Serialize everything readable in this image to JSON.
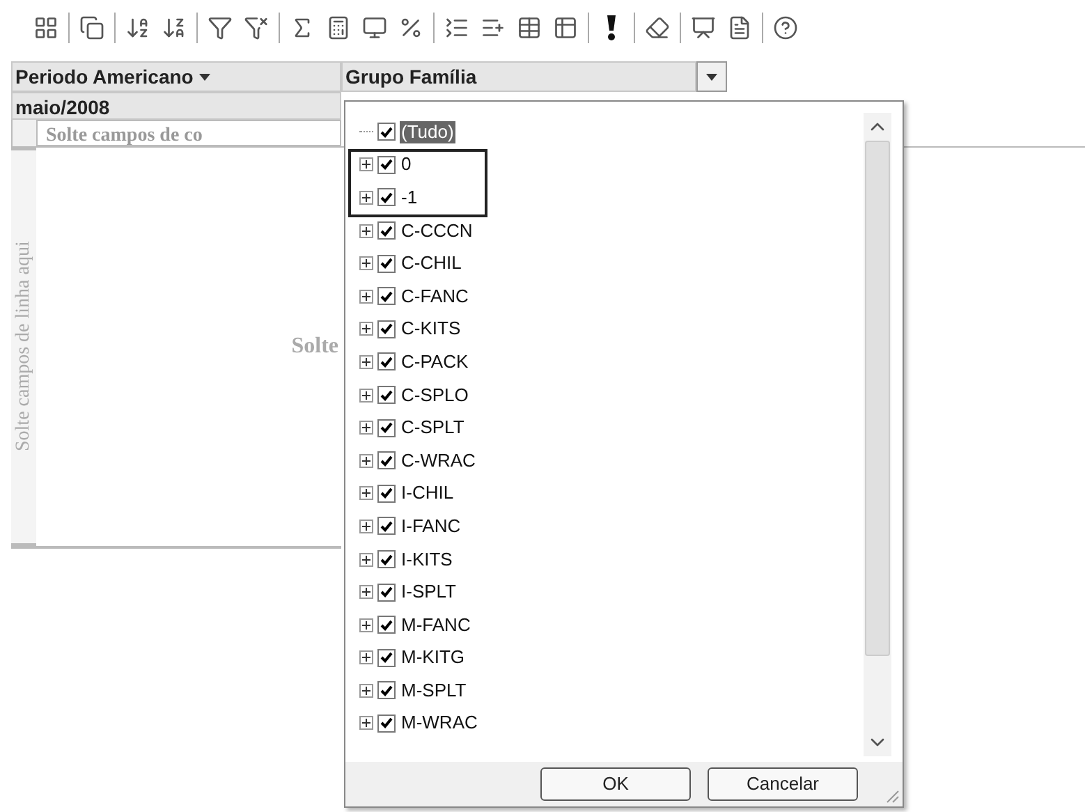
{
  "pivot": {
    "page_field": {
      "label": "Periodo Americano",
      "value": "maio/2008"
    },
    "column_field": {
      "label": "Grupo Família"
    },
    "column_drop_zone": "Solte campos de co",
    "row_drop_zone": "Solte campos de linha aqui",
    "data_drop_zone": "Solte"
  },
  "filter_popup": {
    "items": [
      {
        "label": "(Tudo)",
        "checked": true,
        "selected": true,
        "kind": "all"
      },
      {
        "label": "0",
        "checked": true,
        "selected": false,
        "kind": "group"
      },
      {
        "label": "-1",
        "checked": true,
        "selected": false,
        "kind": "group"
      },
      {
        "label": "C-CCCN",
        "checked": true,
        "selected": false,
        "kind": "group"
      },
      {
        "label": "C-CHIL",
        "checked": true,
        "selected": false,
        "kind": "group"
      },
      {
        "label": "C-FANC",
        "checked": true,
        "selected": false,
        "kind": "group"
      },
      {
        "label": "C-KITS",
        "checked": true,
        "selected": false,
        "kind": "group"
      },
      {
        "label": "C-PACK",
        "checked": true,
        "selected": false,
        "kind": "group"
      },
      {
        "label": "C-SPLO",
        "checked": true,
        "selected": false,
        "kind": "group"
      },
      {
        "label": "C-SPLT",
        "checked": true,
        "selected": false,
        "kind": "group"
      },
      {
        "label": "C-WRAC",
        "checked": true,
        "selected": false,
        "kind": "group"
      },
      {
        "label": "I-CHIL",
        "checked": true,
        "selected": false,
        "kind": "group"
      },
      {
        "label": "I-FANC",
        "checked": true,
        "selected": false,
        "kind": "group"
      },
      {
        "label": "I-KITS",
        "checked": true,
        "selected": false,
        "kind": "group"
      },
      {
        "label": "I-SPLT",
        "checked": true,
        "selected": false,
        "kind": "group"
      },
      {
        "label": "M-FANC",
        "checked": true,
        "selected": false,
        "kind": "group"
      },
      {
        "label": "M-KITG",
        "checked": true,
        "selected": false,
        "kind": "group"
      },
      {
        "label": "M-SPLT",
        "checked": true,
        "selected": false,
        "kind": "group"
      },
      {
        "label": "M-WRAC",
        "checked": true,
        "selected": false,
        "kind": "group"
      }
    ],
    "buttons": [
      "OK",
      "Cancelar"
    ]
  }
}
